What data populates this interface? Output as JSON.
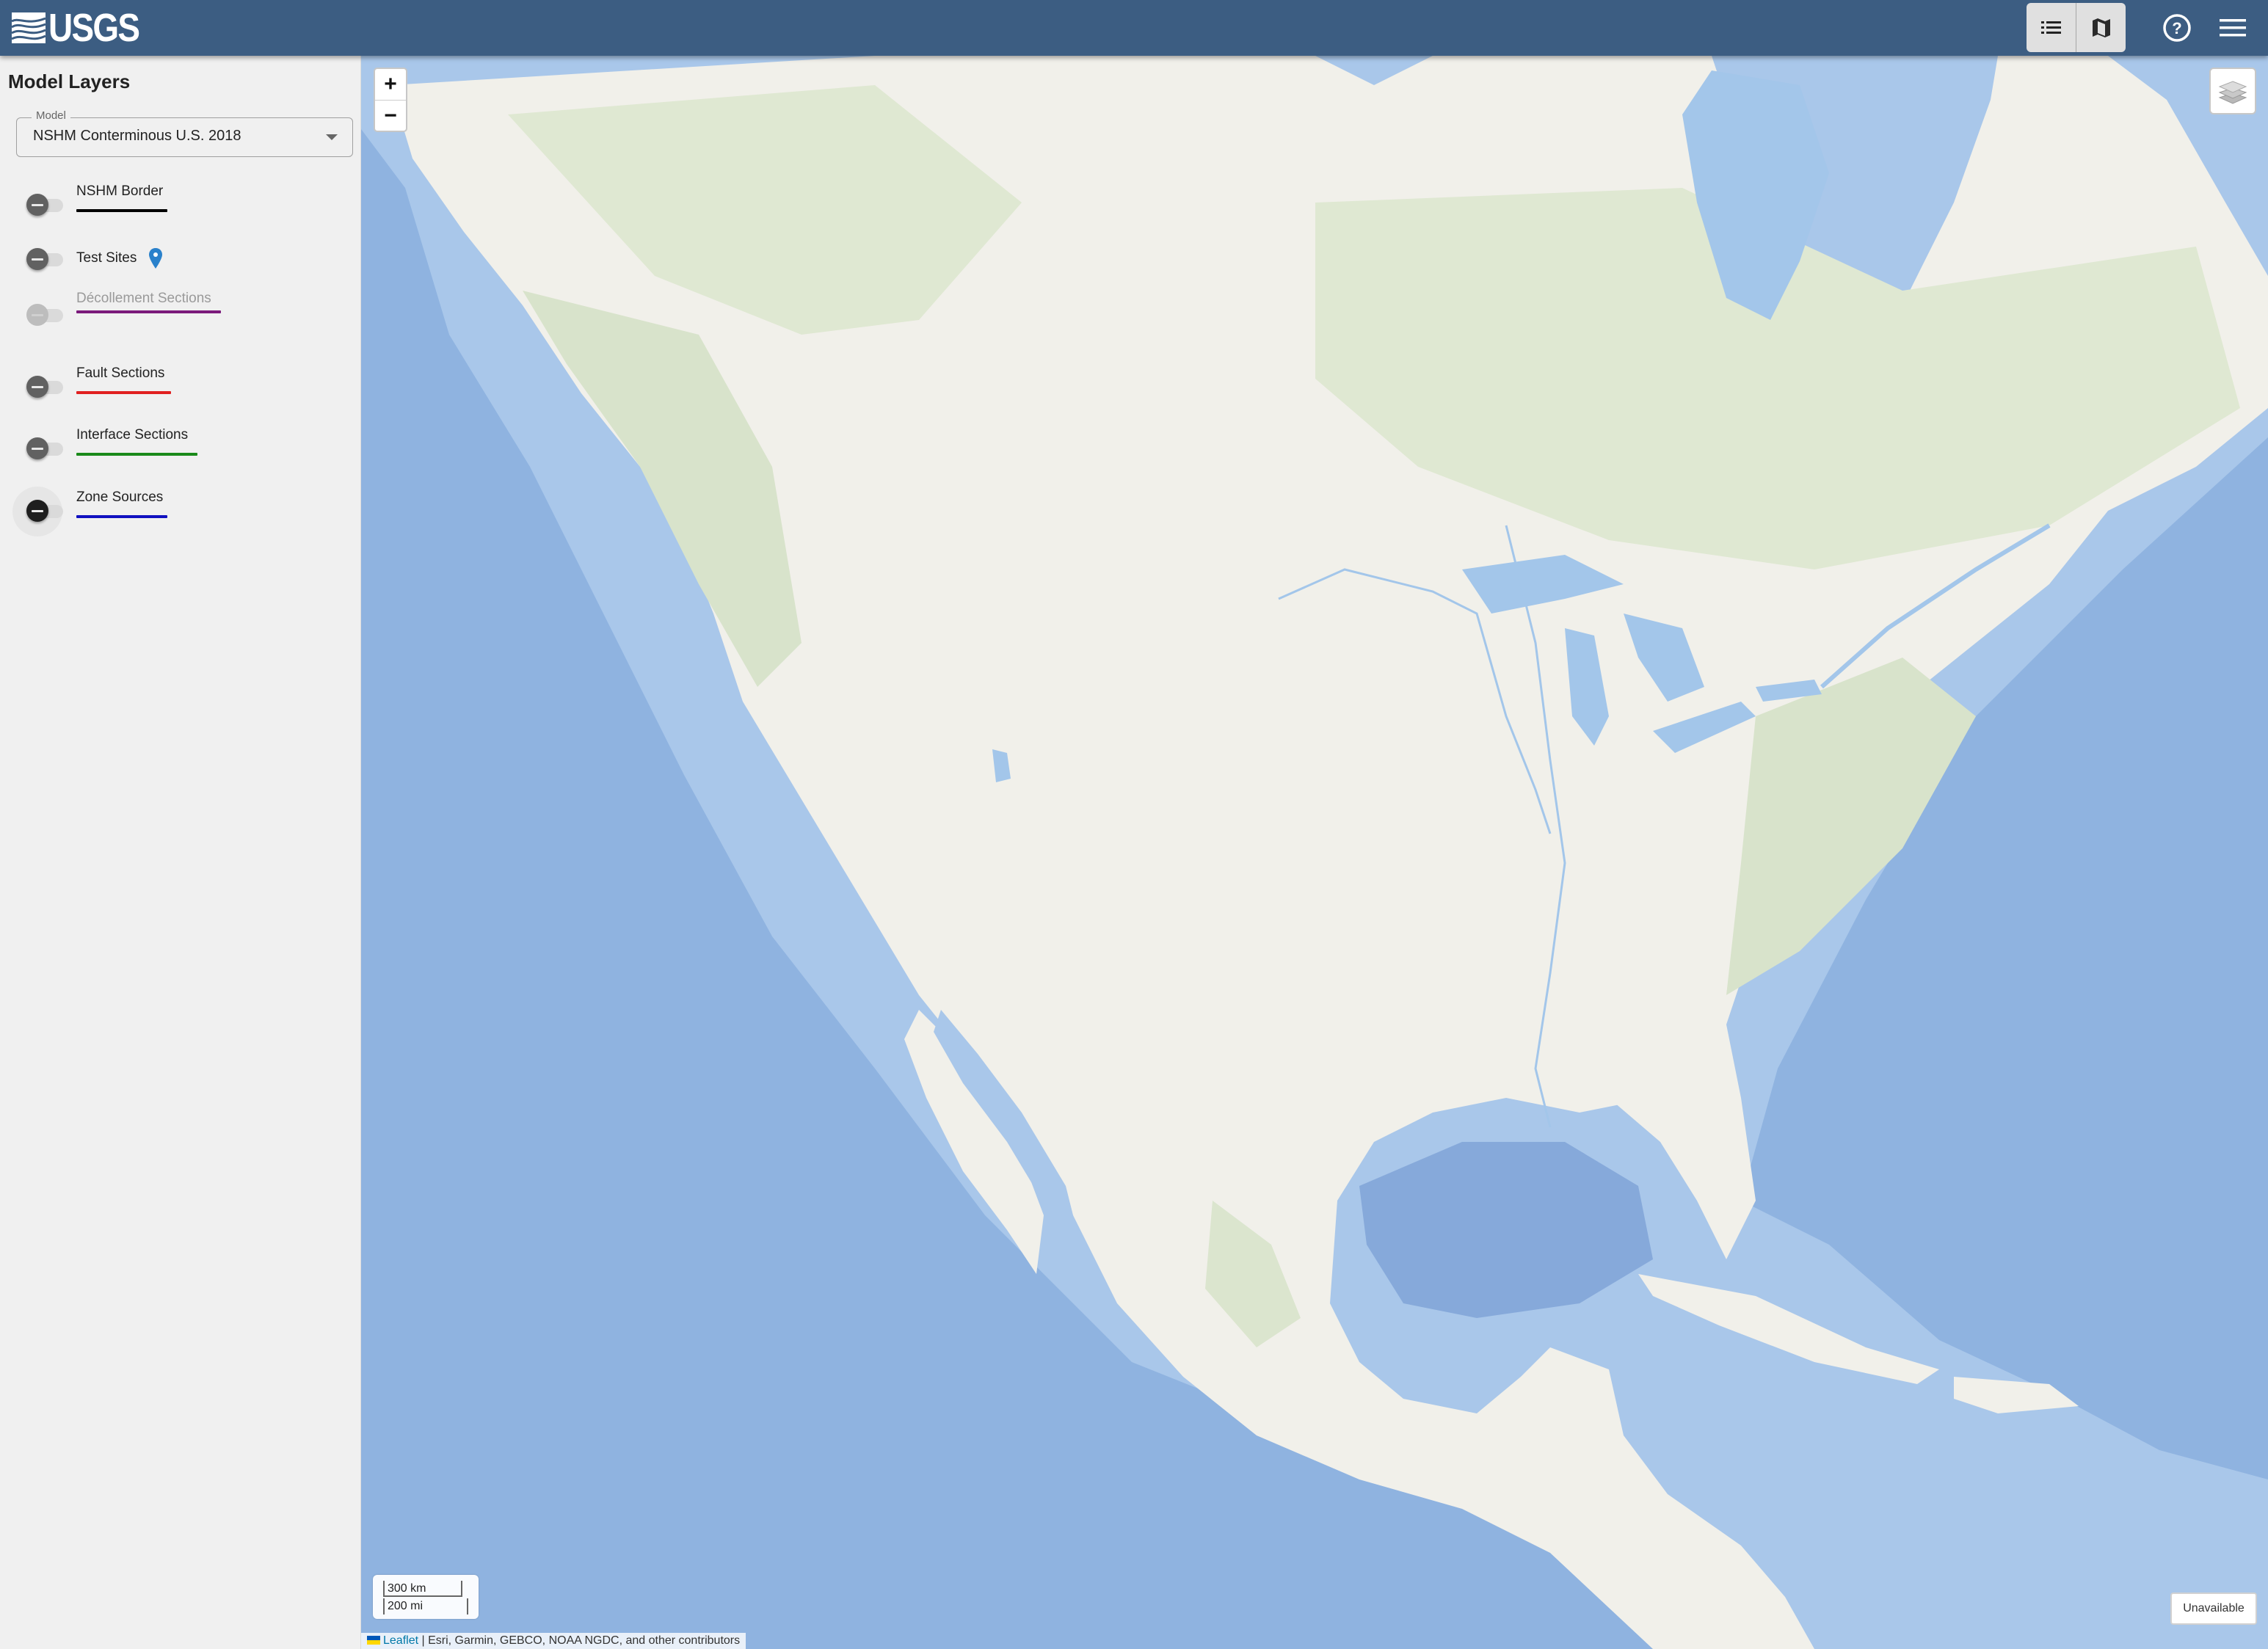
{
  "header": {
    "logo_text": "USGS",
    "view_toggle": [
      {
        "name": "list-view",
        "icon": "list-icon",
        "selected": true
      },
      {
        "name": "map-view",
        "icon": "map-icon",
        "selected": false
      }
    ],
    "help_icon": "help-circle-icon",
    "menu_icon": "hamburger-menu-icon"
  },
  "sidebar": {
    "title": "Model Layers",
    "model_select": {
      "label": "Model",
      "value": "NSHM Conterminous U.S. 2018"
    },
    "layers": [
      {
        "label": "NSHM Border",
        "color": "#000000",
        "enabled": true,
        "checked": false
      },
      {
        "label": "Test Sites",
        "icon": "map-marker-icon",
        "icon_color": "#2a81cb",
        "enabled": true,
        "checked": false
      },
      {
        "label": "Décollement Sections",
        "color": "#7b1a7b",
        "enabled": false,
        "checked": false
      },
      {
        "label": "Fault Sections",
        "color": "#e02020",
        "enabled": true,
        "checked": false
      },
      {
        "label": "Interface Sections",
        "color": "#1a8a1a",
        "enabled": true,
        "checked": false
      },
      {
        "label": "Zone Sources",
        "color": "#1010c0",
        "enabled": true,
        "checked": false,
        "focused": true
      }
    ]
  },
  "map": {
    "zoom_in_label": "+",
    "zoom_out_label": "−",
    "layers_control_icon": "layers-icon",
    "scale": {
      "metric": "300 km",
      "imperial": "200 mi"
    },
    "attribution": {
      "link": "Leaflet",
      "separator": " | ",
      "text": "Esri, Garmin, GEBCO, NOAA NGDC, and other contributors"
    },
    "status_badge": "Unavailable",
    "colors": {
      "ocean": "#8fb3e0",
      "shelf": "#a8c8ec",
      "land": "#f1f0ea",
      "vegetation": "#d6e2c8",
      "water": "#a3c6ea"
    }
  }
}
